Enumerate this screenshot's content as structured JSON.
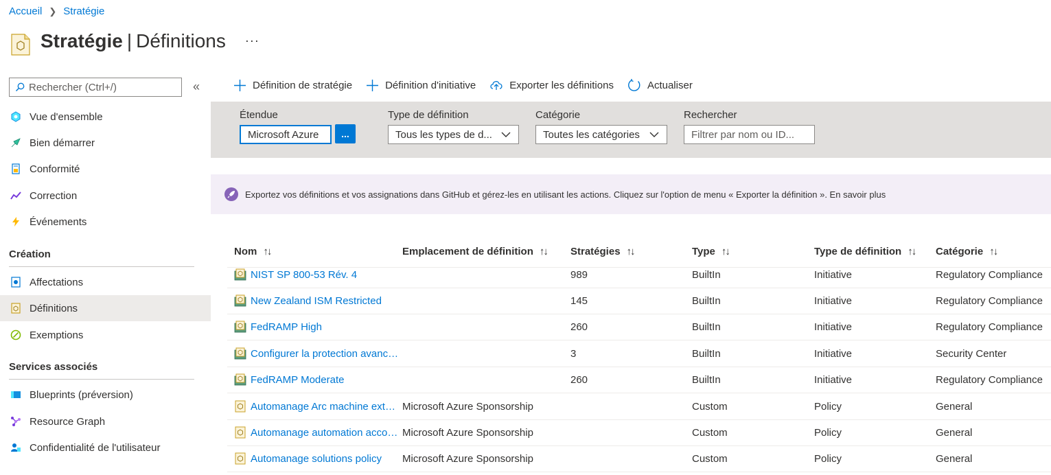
{
  "breadcrumb": {
    "home": "Accueil",
    "current": "Stratégie"
  },
  "header": {
    "title": "Stratégie",
    "separator": "|",
    "subtitle": "Définitions",
    "more": "···"
  },
  "sidebar": {
    "search_placeholder": "Rechercher (Ctrl+/)",
    "collapse": "«",
    "items_top": [
      {
        "label": "Vue d'ensemble",
        "icon": "overview-icon"
      },
      {
        "label": "Bien démarrer",
        "icon": "getting-started-icon"
      },
      {
        "label": "Conformité",
        "icon": "compliance-icon"
      },
      {
        "label": "Correction",
        "icon": "remediation-icon"
      },
      {
        "label": "Événements",
        "icon": "events-icon"
      }
    ],
    "section_creation": "Création",
    "items_creation": [
      {
        "label": "Affectations",
        "icon": "assignments-icon"
      },
      {
        "label": "Définitions",
        "icon": "definitions-icon",
        "selected": true
      },
      {
        "label": "Exemptions",
        "icon": "exemptions-icon"
      }
    ],
    "section_services": "Services associés",
    "items_services": [
      {
        "label": "Blueprints (préversion)",
        "icon": "blueprints-icon"
      },
      {
        "label": "Resource Graph",
        "icon": "resource-graph-icon"
      },
      {
        "label": "Confidentialité de l'utilisateur",
        "icon": "user-privacy-icon"
      }
    ]
  },
  "toolbar": {
    "policy_def": "Définition de stratégie",
    "initiative_def": "Définition d'initiative",
    "export": "Exporter les définitions",
    "refresh": "Actualiser"
  },
  "filters": {
    "scope_label": "Étendue",
    "scope_value": "Microsoft Azure",
    "scope_button": "...",
    "type_label": "Type de définition",
    "type_value": "Tous les types de d...",
    "category_label": "Catégorie",
    "category_value": "Toutes les catégories",
    "search_label": "Rechercher",
    "search_placeholder": "Filtrer par nom ou ID..."
  },
  "banner": {
    "text": "Exportez vos définitions et vos assignations dans GitHub et gérez-les en utilisant les actions. Cliquez sur l'option de menu « Exporter la définition ». En savoir plus",
    "accent": "#8764b8"
  },
  "table": {
    "headers": {
      "name": "Nom",
      "location": "Emplacement de définition",
      "policies": "Stratégies",
      "type": "Type",
      "def_type": "Type de définition",
      "category": "Catégorie",
      "sort_icon": "↑↓"
    },
    "rows": [
      {
        "name": "NIST SP 800-53 Rév. 4",
        "location": "",
        "policies": "989",
        "type": "BuiltIn",
        "def_type": "Initiative",
        "category": "Regulatory Compliance"
      },
      {
        "name": "New Zealand ISM Restricted",
        "location": "",
        "policies": "145",
        "type": "BuiltIn",
        "def_type": "Initiative",
        "category": "Regulatory Compliance"
      },
      {
        "name": "FedRAMP High",
        "location": "",
        "policies": "260",
        "type": "BuiltIn",
        "def_type": "Initiative",
        "category": "Regulatory Compliance"
      },
      {
        "name": "Configurer la protection avancée contre les menaces",
        "location": "",
        "policies": "3",
        "type": "BuiltIn",
        "def_type": "Initiative",
        "category": "Security Center"
      },
      {
        "name": "FedRAMP Moderate",
        "location": "",
        "policies": "260",
        "type": "BuiltIn",
        "def_type": "Initiative",
        "category": "Regulatory Compliance"
      },
      {
        "name": "Automanage Arc machine extension policy",
        "location": "Microsoft Azure Sponsorship",
        "policies": "",
        "type": "Custom",
        "def_type": "Policy",
        "category": "General"
      },
      {
        "name": "Automanage automation account policy",
        "location": "Microsoft Azure Sponsorship",
        "policies": "",
        "type": "Custom",
        "def_type": "Policy",
        "category": "General"
      },
      {
        "name": "Automanage solutions policy",
        "location": "Microsoft Azure Sponsorship",
        "policies": "",
        "type": "Custom",
        "def_type": "Policy",
        "category": "General"
      }
    ]
  },
  "colors": {
    "link": "#0078d4",
    "selected_bg": "#edebe9",
    "filter_bg": "#e1dfdd"
  }
}
